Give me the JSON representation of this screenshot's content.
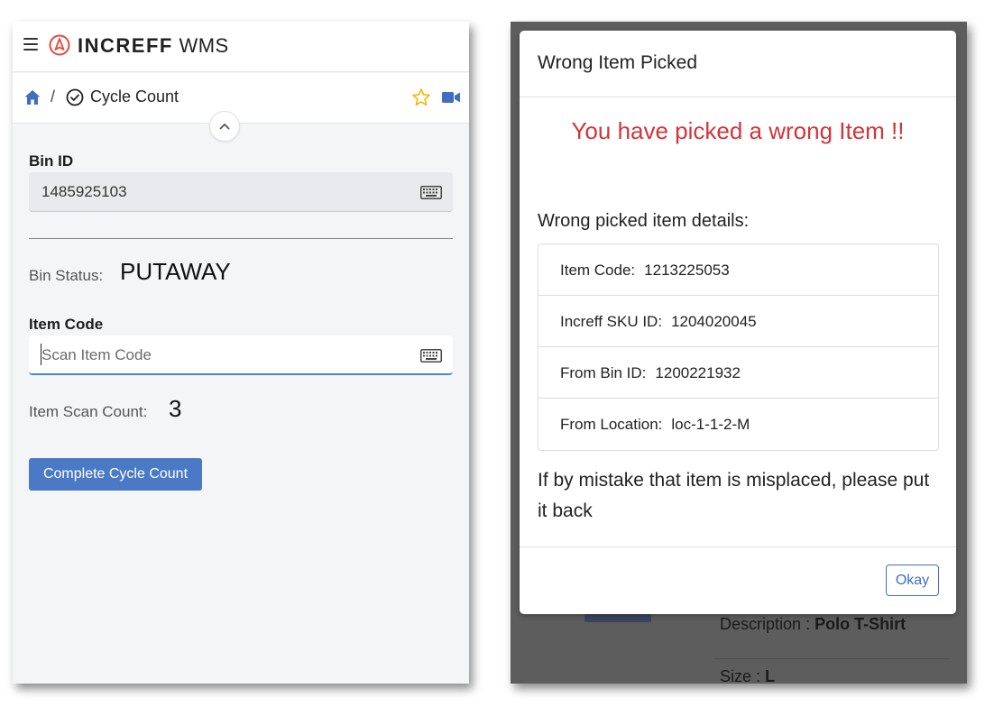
{
  "colors": {
    "accent_blue": "#4a7ac5",
    "logo_red": "#e34a3f",
    "alert_red": "#d0353b",
    "star_yellow": "#f2b705",
    "overlay": "#5d5d5d"
  },
  "left": {
    "app": {
      "brand": "INCREFF",
      "suffix": "WMS",
      "menu_icon": "hamburger-icon",
      "logo_icon": "compass-logo-icon"
    },
    "breadcrumb": {
      "separator": "/",
      "title": "Cycle Count",
      "home_icon": "home-icon",
      "title_icon": "check-circle-icon",
      "favorite_icon": "star-icon",
      "video_icon": "video-icon"
    },
    "bin": {
      "label": "Bin ID",
      "value": "1485925103"
    },
    "bin_status": {
      "label": "Bin Status:",
      "value": "PUTAWAY"
    },
    "item": {
      "label": "Item Code",
      "placeholder": "Scan Item Code"
    },
    "scan_count": {
      "label": "Item Scan Count:",
      "value": "3"
    },
    "complete_button": "Complete Cycle Count"
  },
  "dialog": {
    "title": "Wrong Item Picked",
    "alert": "You have picked a wrong Item !!",
    "details_heading": "Wrong picked item details:",
    "details": [
      {
        "label": "Item Code:",
        "value": "1213225053"
      },
      {
        "label": "Increff SKU ID:",
        "value": "1204020045"
      },
      {
        "label": "From Bin ID:",
        "value": "1200221932"
      },
      {
        "label": "From Location:",
        "value": "loc-1-1-2-M"
      }
    ],
    "note": "If by mistake that item is misplaced, please put it back",
    "okay_button": "Okay"
  },
  "background": {
    "description": {
      "label": "Description",
      "sep": ":",
      "value": "Polo T-Shirt"
    },
    "size": {
      "label": "Size",
      "sep": ":",
      "value": "L"
    }
  }
}
